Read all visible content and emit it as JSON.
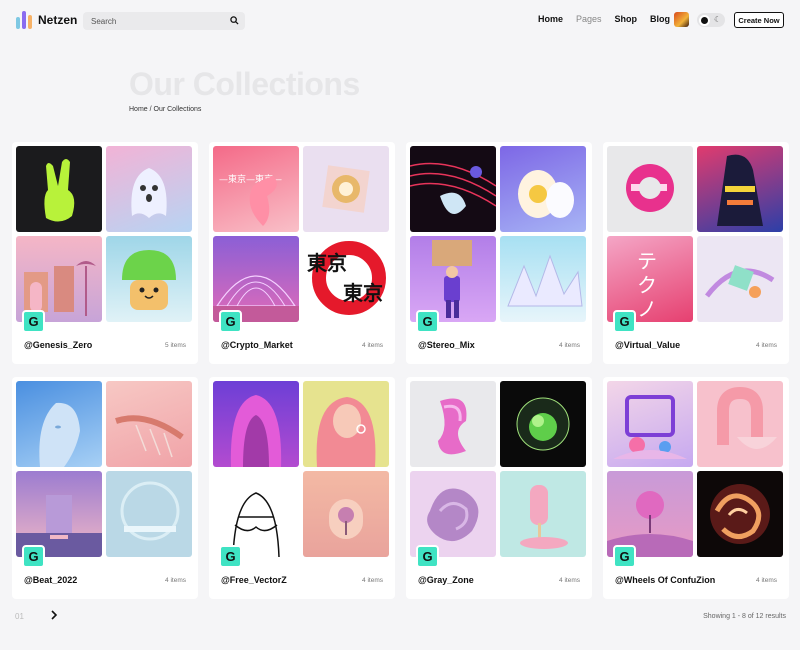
{
  "brand": {
    "name": "Netzen"
  },
  "search": {
    "placeholder": "Search"
  },
  "nav": {
    "home": "Home",
    "pages": "Pages",
    "shop": "Shop",
    "blog": "Blog"
  },
  "header": {
    "create_label": "Create Now"
  },
  "hero": {
    "title": "Our Collections",
    "breadcrumb": "Home / Our Collections"
  },
  "collections": [
    {
      "name": "@Genesis_Zero",
      "count": "5 items",
      "badge": "G"
    },
    {
      "name": "@Crypto_Market",
      "count": "4 items",
      "badge": "G"
    },
    {
      "name": "@Stereo_Mix",
      "count": "4 items",
      "badge": "G"
    },
    {
      "name": "@Virtual_Value",
      "count": "4 items",
      "badge": "G"
    },
    {
      "name": "@Beat_2022",
      "count": "4 items",
      "badge": "G"
    },
    {
      "name": "@Free_VectorZ",
      "count": "4 items",
      "badge": "G"
    },
    {
      "name": "@Gray_Zone",
      "count": "4 items",
      "badge": "G"
    },
    {
      "name": "@Wheels Of ConfuZion",
      "count": "4 items",
      "badge": "G"
    }
  ],
  "pagination": {
    "prev_label": "01",
    "next_icon": "chevron-right-icon",
    "results": "Showing 1 - 8 of 12 results"
  },
  "colors": {
    "accent": "#3fe3c3",
    "background": "#f5f5f7"
  }
}
